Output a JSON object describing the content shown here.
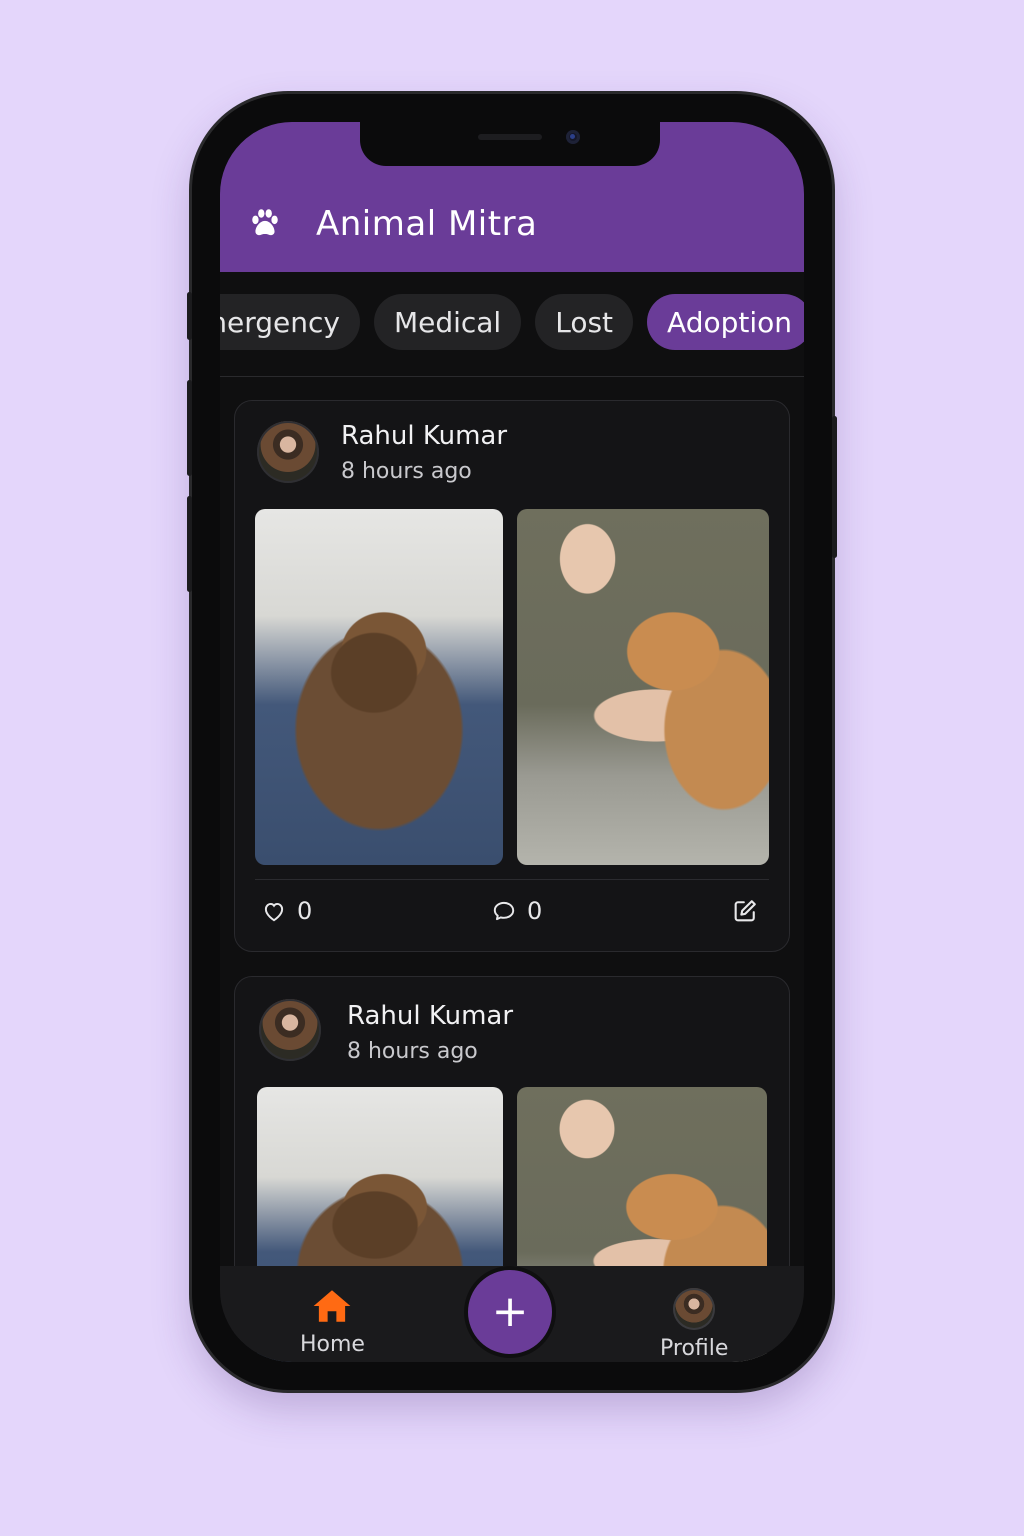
{
  "app": {
    "title": "Animal Mitra",
    "icon": "paw-icon"
  },
  "filters": {
    "chips": [
      {
        "label": "Emergency",
        "active": false
      },
      {
        "label": "Medical",
        "active": false
      },
      {
        "label": "Lost",
        "active": false
      },
      {
        "label": "Adoption",
        "active": true
      }
    ]
  },
  "posts": [
    {
      "author": "Rahul Kumar",
      "time": "8 hours ago",
      "likes": "0",
      "comments": "0"
    },
    {
      "author": "Rahul Kumar",
      "time": "8 hours ago"
    }
  ],
  "nav": {
    "home_label": "Home",
    "add_label": "+",
    "profile_label": "Profile"
  },
  "colors": {
    "accent": "#6a3c98",
    "home_active": "#ff6a13",
    "background": "#e4d6fb"
  }
}
